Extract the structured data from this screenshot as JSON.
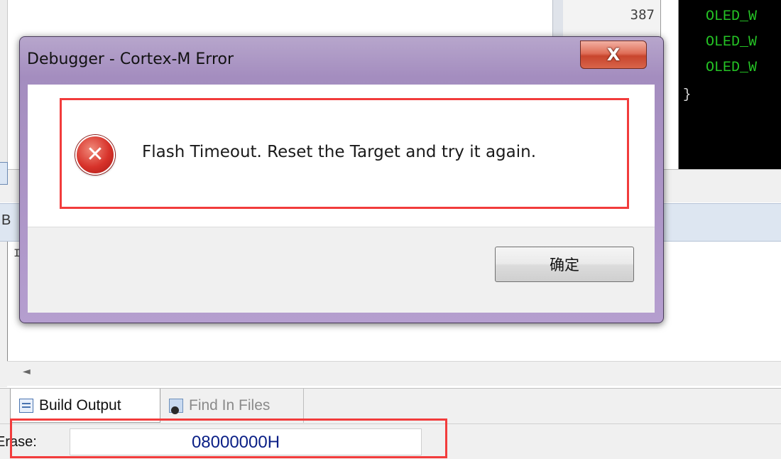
{
  "background_ide": {
    "line_number": "387",
    "code_lines": [
      "OLED_W",
      "OLED_W",
      "OLED_W"
    ],
    "closing_brace": "}",
    "build_panel_header_fragment": "B",
    "build_panel_text_fragment": "I",
    "scroll_left_arrow": "◄",
    "tabs": [
      {
        "label": "Build Output",
        "icon": "build-output-icon",
        "active": true
      },
      {
        "label": "Find In Files",
        "icon": "find-in-files-icon",
        "active": false
      }
    ],
    "status": {
      "label": "Erase:",
      "value": "08000000H"
    }
  },
  "dialog": {
    "title": "Debugger - Cortex-M Error",
    "close_label": "X",
    "icon": "error-icon",
    "message": "Flash Timeout. Reset the Target and try it again.",
    "ok_label": "确定"
  },
  "colors": {
    "code_text": "#25c425",
    "code_background": "#000000",
    "dialog_frame": "#a48dbf",
    "close_button": "#d8644a",
    "highlight": "#f23c3c",
    "status_value_text": "#0a1f86"
  }
}
